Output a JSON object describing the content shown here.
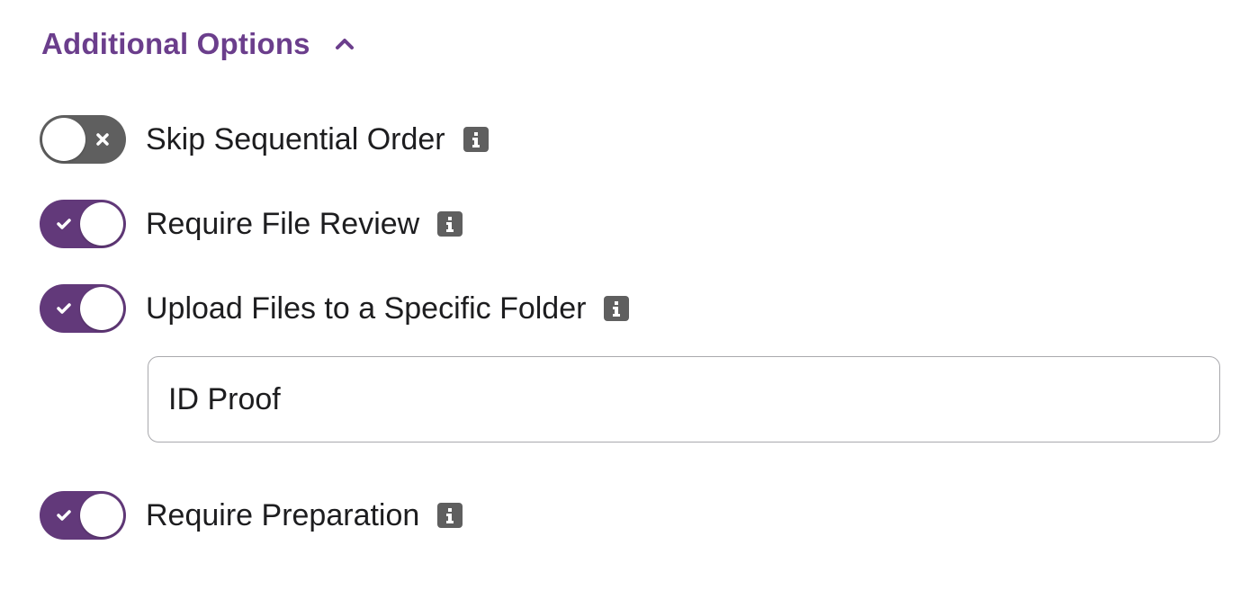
{
  "section": {
    "title": "Additional Options",
    "expanded": true,
    "accent_color": "#6b3e8c"
  },
  "options": [
    {
      "label": "Skip Sequential Order",
      "enabled": false
    },
    {
      "label": "Require File Review",
      "enabled": true
    },
    {
      "label": "Upload Files to a Specific Folder",
      "enabled": true
    },
    {
      "label": "Require Preparation",
      "enabled": true
    }
  ],
  "folder_input": {
    "value": "ID Proof"
  },
  "colors": {
    "toggle_on": "#62397a",
    "toggle_off": "#5f5f5f",
    "info_icon": "#5f5f5f"
  },
  "icons": {
    "section_toggle": "chevron-up-icon",
    "info": "info-icon",
    "on_mark": "checkmark-icon",
    "off_mark": "x-icon"
  }
}
